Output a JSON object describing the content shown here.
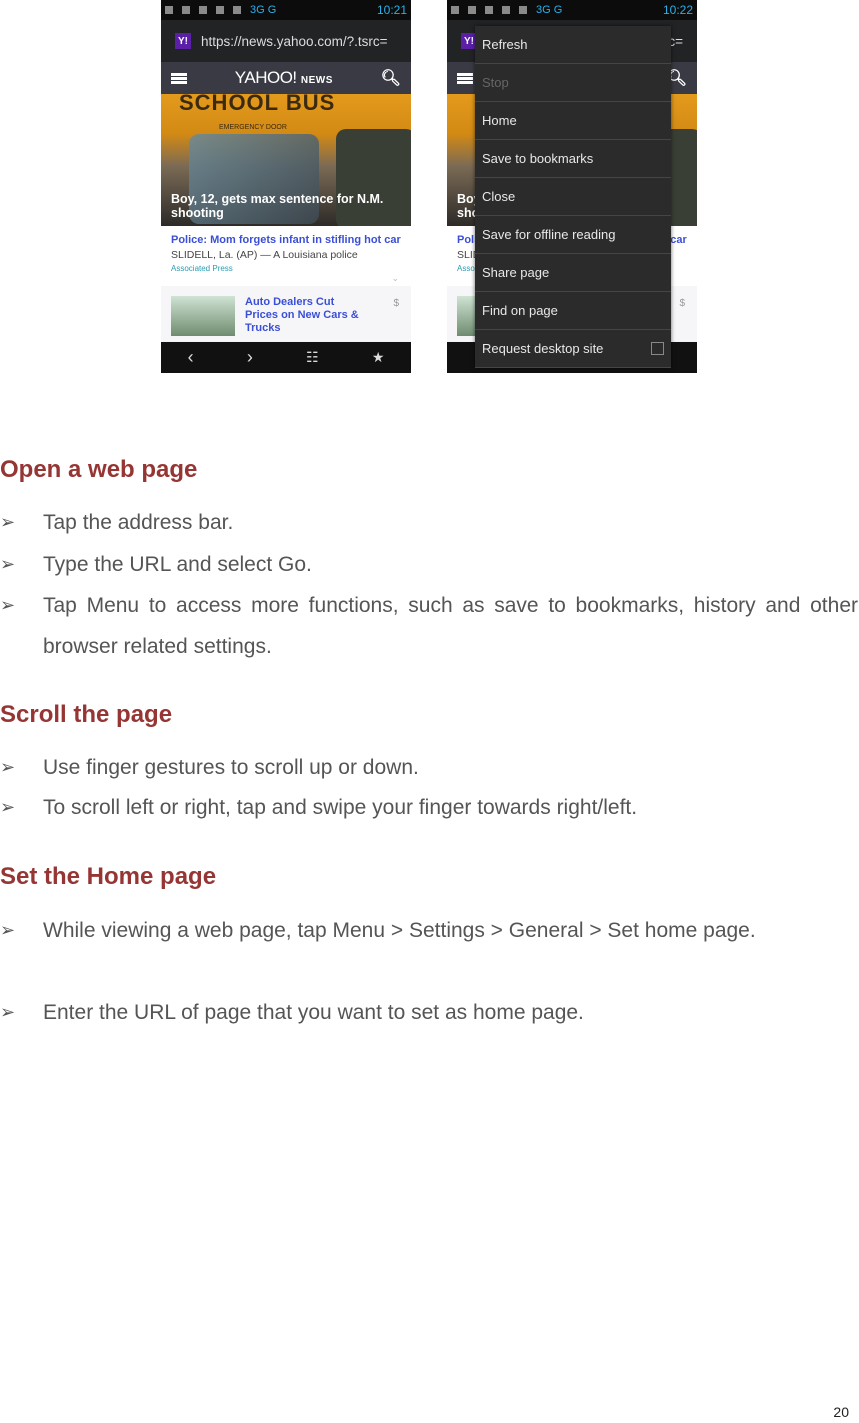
{
  "screenshots": [
    {
      "status_time": "10:21",
      "network": "3G G",
      "url": "https://news.yahoo.com/?.tsrc=",
      "favicon": "Y!",
      "site_logo": "YAHOO!",
      "site_section": "NEWS",
      "hero_bus_text": "SCHOOL BUS",
      "hero_door_text": "EMERGENCY DOOR",
      "hero_headline": "Boy, 12, gets max sentence for N.M. shooting",
      "story_title": "Police: Mom forgets infant in stifling hot car",
      "story_snippet": "SLIDELL, La. (AP) — A Louisiana police",
      "story_source": "Associated Press",
      "ad_title": "Auto Dealers Cut Prices on New Cars & Trucks",
      "ad_badge": "$",
      "bottom_nav": [
        "back-icon",
        "forward-icon",
        "tabs-icon",
        "bookmark-icon"
      ]
    },
    {
      "status_time": "10:22",
      "url_tail": "rc=",
      "menu_items": [
        {
          "label": "Refresh",
          "enabled": true
        },
        {
          "label": "Stop",
          "enabled": false
        },
        {
          "label": "Home",
          "enabled": true
        },
        {
          "label": "Save to bookmarks",
          "enabled": true
        },
        {
          "label": "Close",
          "enabled": true
        },
        {
          "label": "Save for offline reading",
          "enabled": true
        },
        {
          "label": "Share page",
          "enabled": true
        },
        {
          "label": "Find on page",
          "enabled": true
        },
        {
          "label": "Request desktop site",
          "enabled": true,
          "checkbox": false
        }
      ]
    }
  ],
  "sections": [
    {
      "heading": "Open a web page",
      "bullets": [
        "Tap the address bar.",
        "Type the URL and select Go.",
        "Tap Menu to access more functions, such as save to bookmarks, history and other browser related settings."
      ]
    },
    {
      "heading": "Scroll the page",
      "bullets": [
        "Use finger gestures to scroll up or down.",
        "To scroll left or right, tap and swipe your finger towards right/left."
      ]
    },
    {
      "heading": "Set the Home page",
      "bullets": [
        "While viewing a web page, tap Menu > Settings > General > Set home page.",
        "Enter the URL of page that you want to set as home page."
      ]
    }
  ],
  "bullet_glyph": "➢",
  "page_number": "20",
  "colors": {
    "heading": "#963634",
    "body_text": "#555555",
    "link_blue": "#3b4fd6"
  }
}
